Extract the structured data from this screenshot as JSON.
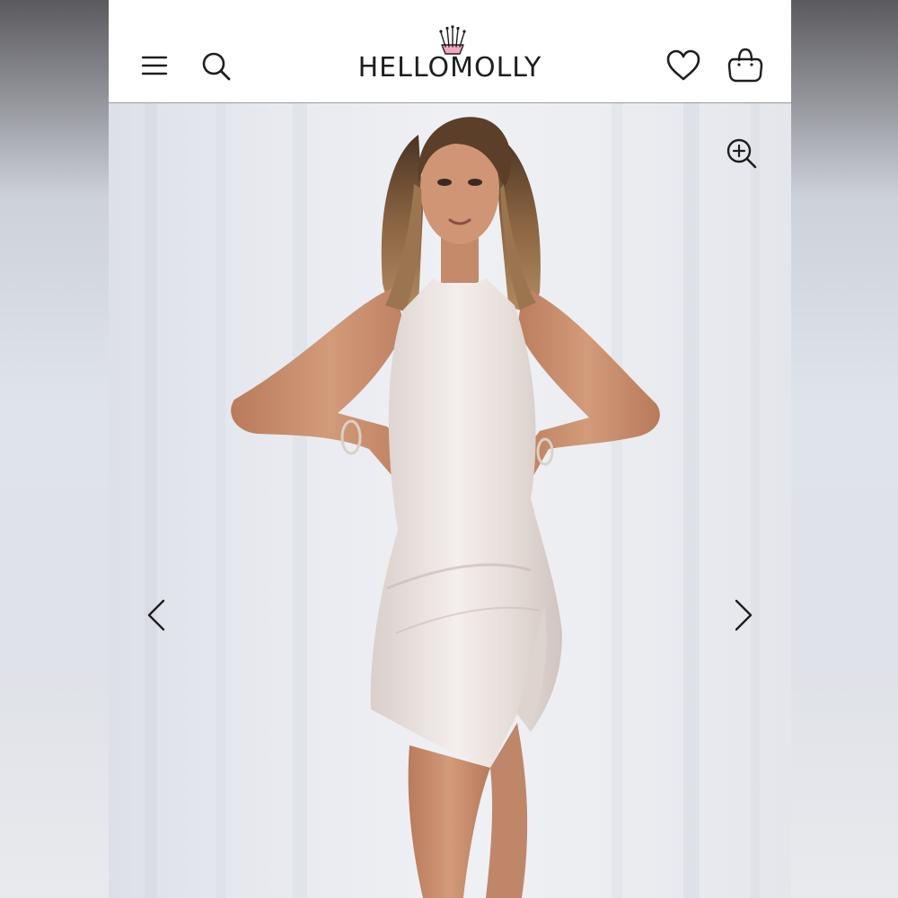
{
  "header": {
    "brand_name": "HELLOMOLLY",
    "menu_icon": "hamburger-menu-icon",
    "search_icon": "search-icon",
    "wishlist_icon": "heart-icon",
    "bag_icon": "shopping-bag-icon",
    "crown_icon": "crown-icon"
  },
  "gallery": {
    "zoom_icon": "zoom-in-icon",
    "prev_icon": "chevron-left-icon",
    "next_icon": "chevron-right-icon",
    "image_subject": "model-in-satin-halter-mini-dress"
  },
  "colors": {
    "header_bg": "#ffffff",
    "icon": "#1e1e1e",
    "crown_pink": "#f4a7c4",
    "dress": "#eee6e3",
    "skin": "#c98f6e",
    "hair": "#7a5636"
  }
}
